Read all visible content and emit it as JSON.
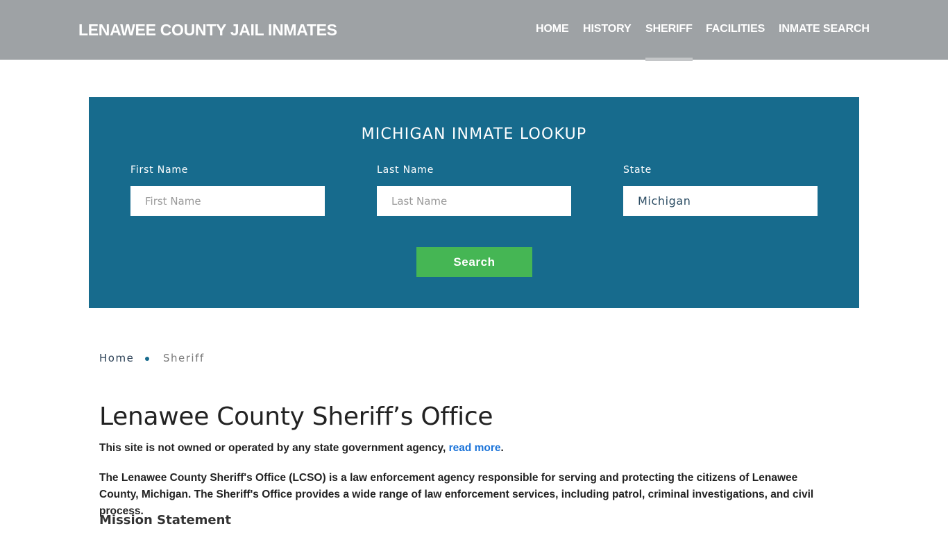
{
  "header": {
    "brand": "LENAWEE COUNTY JAIL INMATES",
    "nav": [
      {
        "label": "HOME",
        "active": false
      },
      {
        "label": "HISTORY",
        "active": false
      },
      {
        "label": "SHERIFF",
        "active": true
      },
      {
        "label": "FACILITIES",
        "active": false
      },
      {
        "label": "INMATE SEARCH",
        "active": false
      }
    ]
  },
  "lookup": {
    "title": "MICHIGAN INMATE LOOKUP",
    "first_name": {
      "label": "First Name",
      "placeholder": "First Name",
      "value": ""
    },
    "last_name": {
      "label": "Last Name",
      "placeholder": "Last Name",
      "value": ""
    },
    "state": {
      "label": "State",
      "value": "Michigan"
    },
    "search_label": "Search"
  },
  "breadcrumb": {
    "home": "Home",
    "current": "Sheriff"
  },
  "content": {
    "title": "Lenawee County Sheriff’s Office",
    "disclaimer_text": "This site is not owned or operated by any state government agency, ",
    "disclaimer_link": "read more",
    "disclaimer_end": ".",
    "intro": "The Lenawee County Sheriff's Office (LCSO) is a law enforcement agency responsible for serving and protecting the citizens of Lenawee County, Michigan. The Sheriff's Office provides a wide range of law enforcement services, including patrol, criminal investigations, and civil process.",
    "section_heading": "Mission Statement"
  },
  "colors": {
    "header_bg": "#9ea2a5",
    "lookup_bg": "#176b8d",
    "search_button": "#45b654",
    "link": "#1a73d9"
  }
}
